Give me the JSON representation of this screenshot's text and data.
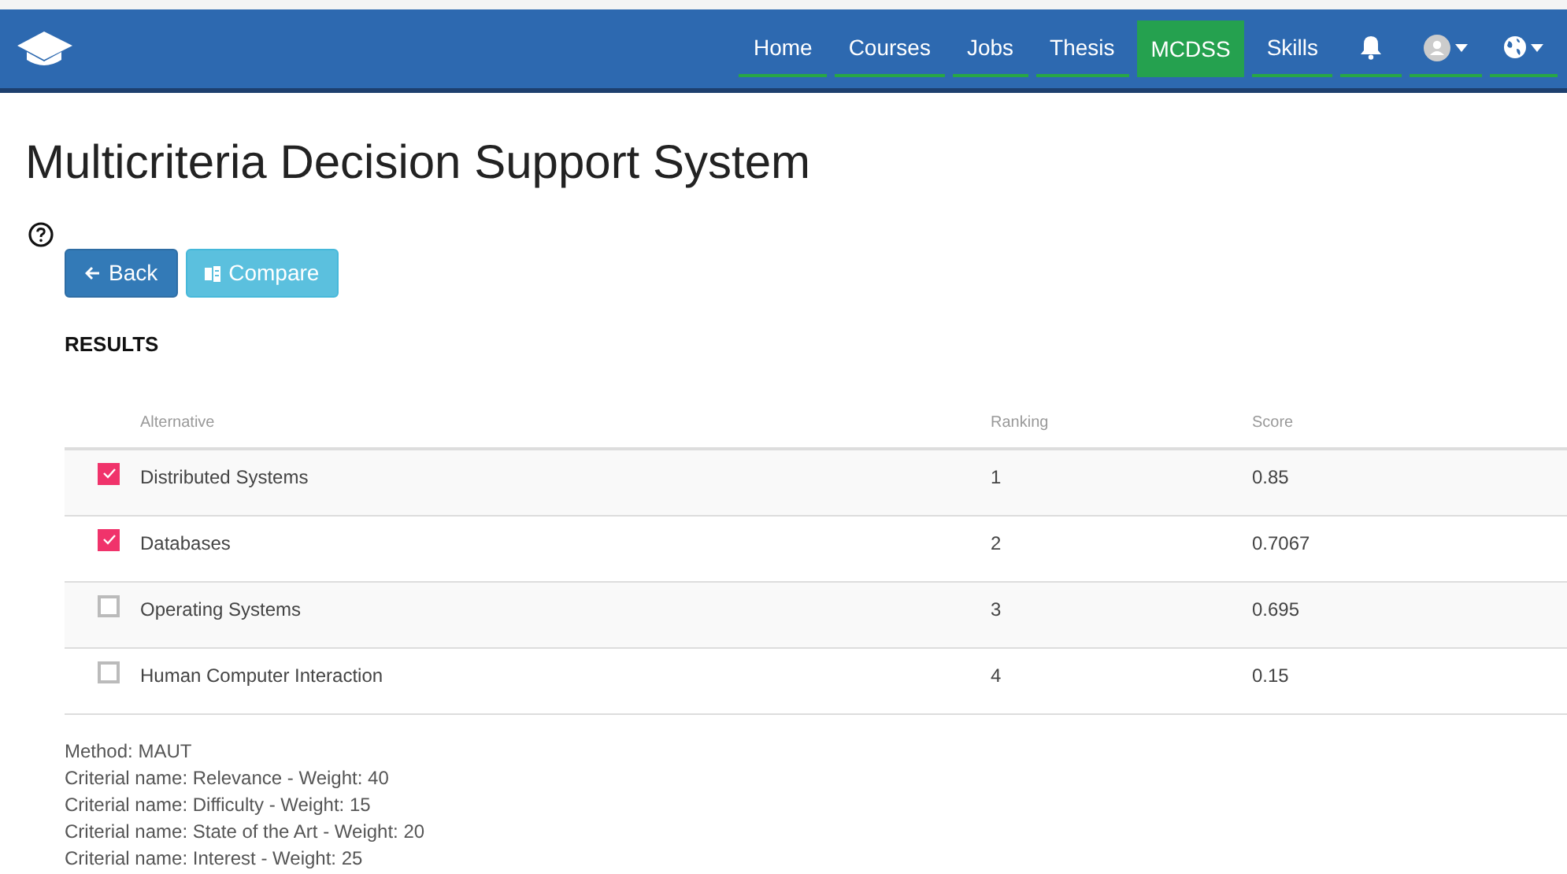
{
  "nav": [
    {
      "kind": "text",
      "label": "Home",
      "selected": false
    },
    {
      "kind": "text",
      "label": "Courses",
      "selected": false
    },
    {
      "kind": "text",
      "label": "Jobs",
      "selected": false
    },
    {
      "kind": "text",
      "label": "Thesis",
      "selected": false
    },
    {
      "kind": "text",
      "label": "MCDSS",
      "selected": true
    },
    {
      "kind": "text",
      "label": "Skills",
      "selected": false
    },
    {
      "kind": "bell",
      "selected": false
    },
    {
      "kind": "avatar",
      "selected": false
    },
    {
      "kind": "globe",
      "selected": false
    }
  ],
  "title": "Multicriteria Decision Support System",
  "buttons": [
    {
      "kind": "back",
      "label": "Back"
    },
    {
      "kind": "compare",
      "label": "Compare"
    }
  ],
  "section": "RESULTS",
  "table": {
    "columns": [
      "Alternative",
      "Ranking",
      "Score"
    ],
    "rows": [
      {
        "checked": true,
        "cells": [
          "Distributed Systems",
          "1",
          "0.85"
        ]
      },
      {
        "checked": true,
        "cells": [
          "Databases",
          "2",
          "0.7067"
        ]
      },
      {
        "checked": false,
        "cells": [
          "Operating Systems",
          "3",
          "0.695"
        ]
      },
      {
        "checked": false,
        "cells": [
          "Human Computer Interaction",
          "4",
          "0.15"
        ]
      }
    ]
  },
  "details": [
    "Method: MAUT",
    "Criterial name: Relevance - Weight: 40",
    "Criterial name: Difficulty - Weight: 15",
    "Criterial name: State of the Art - Weight: 20",
    "Criterial name: Interest - Weight: 25"
  ]
}
